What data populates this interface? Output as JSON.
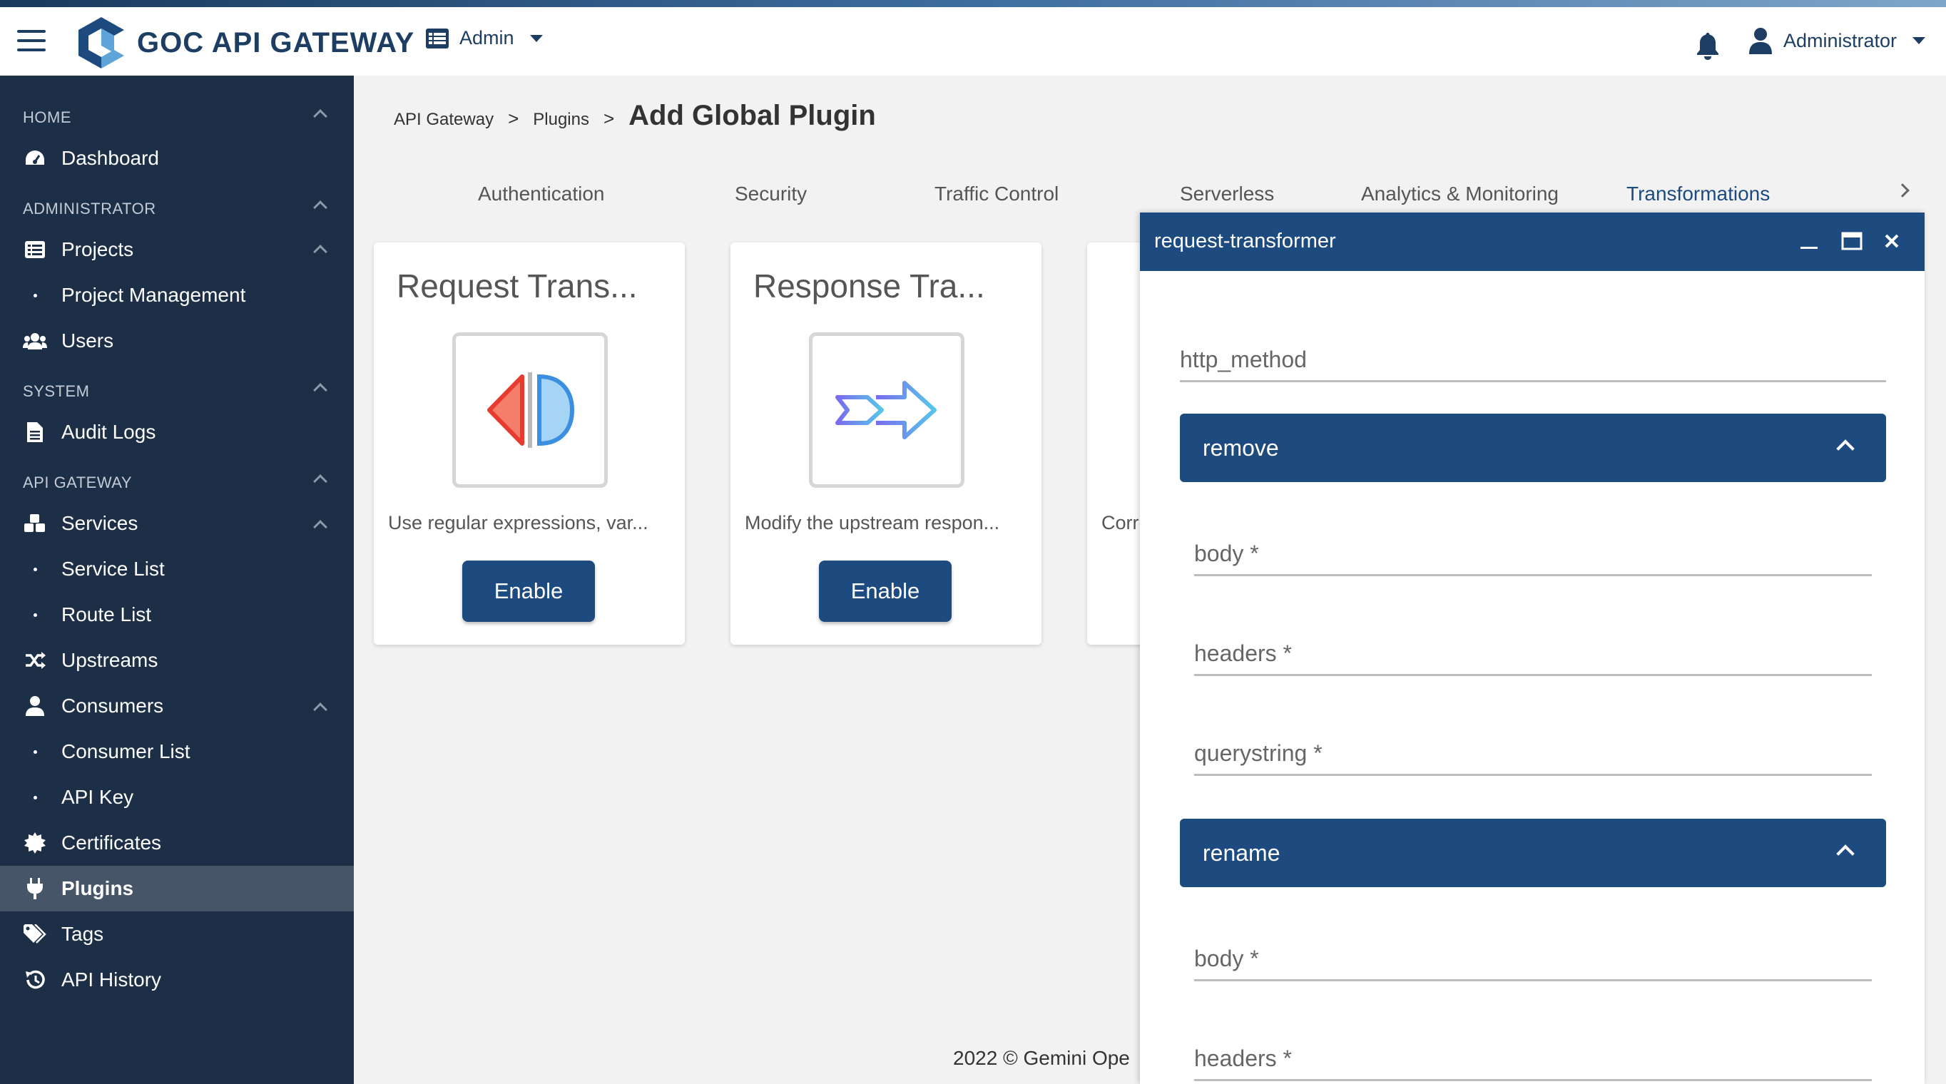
{
  "topbar": {
    "brand": "GOC API GATEWAY",
    "admin_menu": "Admin",
    "user_menu": "Administrator"
  },
  "sidebar": {
    "sections": {
      "home": "HOME",
      "administrator": "ADMINISTRATOR",
      "system": "SYSTEM",
      "api_gateway": "API GATEWAY"
    },
    "items": {
      "dashboard": "Dashboard",
      "projects": "Projects",
      "project_management": "Project Management",
      "users": "Users",
      "audit_logs": "Audit Logs",
      "services": "Services",
      "service_list": "Service List",
      "route_list": "Route List",
      "upstreams": "Upstreams",
      "consumers": "Consumers",
      "consumer_list": "Consumer List",
      "api_key": "API Key",
      "certificates": "Certificates",
      "plugins": "Plugins",
      "tags": "Tags",
      "api_history": "API History"
    },
    "active": "Plugins"
  },
  "breadcrumb": {
    "level1": "API Gateway",
    "sep": ">",
    "level2": "Plugins",
    "title": "Add Global Plugin"
  },
  "tabs": {
    "authentication": "Authentication",
    "security": "Security",
    "traffic_control": "Traffic Control",
    "serverless": "Serverless",
    "analytics": "Analytics & Monitoring",
    "transformations": "Transformations"
  },
  "cards": {
    "request": {
      "title": "Request Trans...",
      "desc": "Use regular expressions, var...",
      "button": "Enable"
    },
    "response": {
      "title": "Response Tra...",
      "desc": "Modify the upstream respon...",
      "button": "Enable"
    },
    "third": {
      "desc": "Corr"
    }
  },
  "footer": {
    "text": "2022 © Gemini Ope"
  },
  "panel": {
    "title": "request-transformer",
    "http_method": "http_method",
    "remove": {
      "label": "remove",
      "body": "body",
      "headers": "headers",
      "querystring": "querystring"
    },
    "rename": {
      "label": "rename",
      "body": "body",
      "headers": "headers"
    },
    "required_mark": "*"
  },
  "colors": {
    "primary": "#1d4b80",
    "sidebar_bg": "#1c2f46",
    "active_item_bg": "#475569"
  }
}
